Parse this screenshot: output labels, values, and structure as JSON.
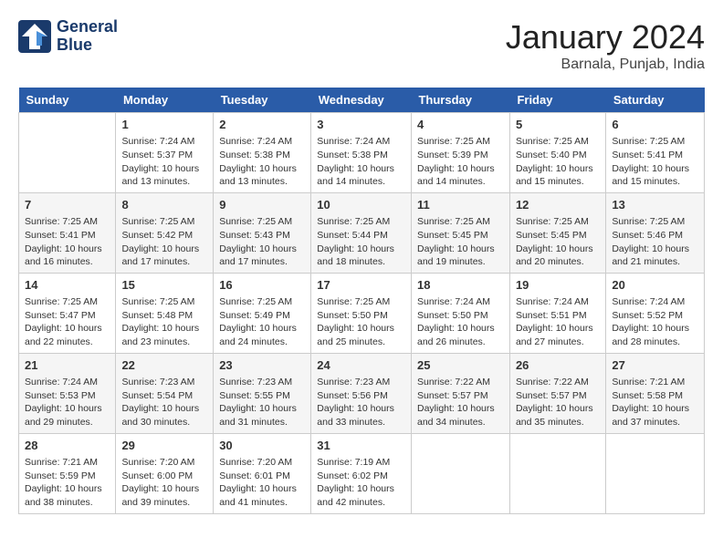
{
  "header": {
    "logo_line1": "General",
    "logo_line2": "Blue",
    "month": "January 2024",
    "location": "Barnala, Punjab, India"
  },
  "weekdays": [
    "Sunday",
    "Monday",
    "Tuesday",
    "Wednesday",
    "Thursday",
    "Friday",
    "Saturday"
  ],
  "weeks": [
    [
      {
        "day": "",
        "info": ""
      },
      {
        "day": "1",
        "info": "Sunrise: 7:24 AM\nSunset: 5:37 PM\nDaylight: 10 hours\nand 13 minutes."
      },
      {
        "day": "2",
        "info": "Sunrise: 7:24 AM\nSunset: 5:38 PM\nDaylight: 10 hours\nand 13 minutes."
      },
      {
        "day": "3",
        "info": "Sunrise: 7:24 AM\nSunset: 5:38 PM\nDaylight: 10 hours\nand 14 minutes."
      },
      {
        "day": "4",
        "info": "Sunrise: 7:25 AM\nSunset: 5:39 PM\nDaylight: 10 hours\nand 14 minutes."
      },
      {
        "day": "5",
        "info": "Sunrise: 7:25 AM\nSunset: 5:40 PM\nDaylight: 10 hours\nand 15 minutes."
      },
      {
        "day": "6",
        "info": "Sunrise: 7:25 AM\nSunset: 5:41 PM\nDaylight: 10 hours\nand 15 minutes."
      }
    ],
    [
      {
        "day": "7",
        "info": "Sunrise: 7:25 AM\nSunset: 5:41 PM\nDaylight: 10 hours\nand 16 minutes."
      },
      {
        "day": "8",
        "info": "Sunrise: 7:25 AM\nSunset: 5:42 PM\nDaylight: 10 hours\nand 17 minutes."
      },
      {
        "day": "9",
        "info": "Sunrise: 7:25 AM\nSunset: 5:43 PM\nDaylight: 10 hours\nand 17 minutes."
      },
      {
        "day": "10",
        "info": "Sunrise: 7:25 AM\nSunset: 5:44 PM\nDaylight: 10 hours\nand 18 minutes."
      },
      {
        "day": "11",
        "info": "Sunrise: 7:25 AM\nSunset: 5:45 PM\nDaylight: 10 hours\nand 19 minutes."
      },
      {
        "day": "12",
        "info": "Sunrise: 7:25 AM\nSunset: 5:45 PM\nDaylight: 10 hours\nand 20 minutes."
      },
      {
        "day": "13",
        "info": "Sunrise: 7:25 AM\nSunset: 5:46 PM\nDaylight: 10 hours\nand 21 minutes."
      }
    ],
    [
      {
        "day": "14",
        "info": "Sunrise: 7:25 AM\nSunset: 5:47 PM\nDaylight: 10 hours\nand 22 minutes."
      },
      {
        "day": "15",
        "info": "Sunrise: 7:25 AM\nSunset: 5:48 PM\nDaylight: 10 hours\nand 23 minutes."
      },
      {
        "day": "16",
        "info": "Sunrise: 7:25 AM\nSunset: 5:49 PM\nDaylight: 10 hours\nand 24 minutes."
      },
      {
        "day": "17",
        "info": "Sunrise: 7:25 AM\nSunset: 5:50 PM\nDaylight: 10 hours\nand 25 minutes."
      },
      {
        "day": "18",
        "info": "Sunrise: 7:24 AM\nSunset: 5:50 PM\nDaylight: 10 hours\nand 26 minutes."
      },
      {
        "day": "19",
        "info": "Sunrise: 7:24 AM\nSunset: 5:51 PM\nDaylight: 10 hours\nand 27 minutes."
      },
      {
        "day": "20",
        "info": "Sunrise: 7:24 AM\nSunset: 5:52 PM\nDaylight: 10 hours\nand 28 minutes."
      }
    ],
    [
      {
        "day": "21",
        "info": "Sunrise: 7:24 AM\nSunset: 5:53 PM\nDaylight: 10 hours\nand 29 minutes."
      },
      {
        "day": "22",
        "info": "Sunrise: 7:23 AM\nSunset: 5:54 PM\nDaylight: 10 hours\nand 30 minutes."
      },
      {
        "day": "23",
        "info": "Sunrise: 7:23 AM\nSunset: 5:55 PM\nDaylight: 10 hours\nand 31 minutes."
      },
      {
        "day": "24",
        "info": "Sunrise: 7:23 AM\nSunset: 5:56 PM\nDaylight: 10 hours\nand 33 minutes."
      },
      {
        "day": "25",
        "info": "Sunrise: 7:22 AM\nSunset: 5:57 PM\nDaylight: 10 hours\nand 34 minutes."
      },
      {
        "day": "26",
        "info": "Sunrise: 7:22 AM\nSunset: 5:57 PM\nDaylight: 10 hours\nand 35 minutes."
      },
      {
        "day": "27",
        "info": "Sunrise: 7:21 AM\nSunset: 5:58 PM\nDaylight: 10 hours\nand 37 minutes."
      }
    ],
    [
      {
        "day": "28",
        "info": "Sunrise: 7:21 AM\nSunset: 5:59 PM\nDaylight: 10 hours\nand 38 minutes."
      },
      {
        "day": "29",
        "info": "Sunrise: 7:20 AM\nSunset: 6:00 PM\nDaylight: 10 hours\nand 39 minutes."
      },
      {
        "day": "30",
        "info": "Sunrise: 7:20 AM\nSunset: 6:01 PM\nDaylight: 10 hours\nand 41 minutes."
      },
      {
        "day": "31",
        "info": "Sunrise: 7:19 AM\nSunset: 6:02 PM\nDaylight: 10 hours\nand 42 minutes."
      },
      {
        "day": "",
        "info": ""
      },
      {
        "day": "",
        "info": ""
      },
      {
        "day": "",
        "info": ""
      }
    ]
  ]
}
